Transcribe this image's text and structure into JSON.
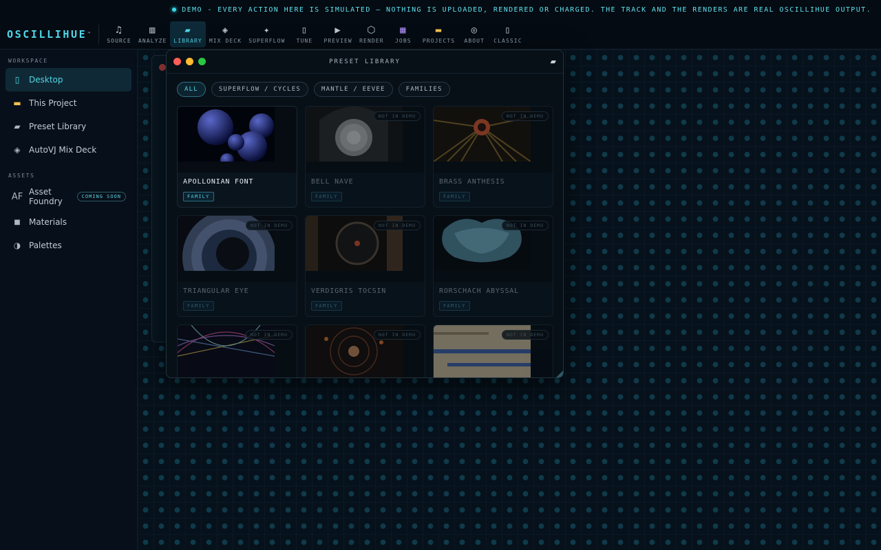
{
  "ticker": {
    "text": "DEMO - EVERY ACTION HERE IS SIMULATED — NOTHING IS UPLOADED, RENDERED OR CHARGED. THE TRACK AND THE RENDERS ARE REAL OSCILLIHUE OUTPUT."
  },
  "brand": {
    "name": "OSCILLIHUE",
    "tm": "™"
  },
  "nav": [
    {
      "label": "SOURCE",
      "icon": "music-note-icon",
      "glyph": "♫"
    },
    {
      "label": "ANALYZE",
      "icon": "bar-chart-icon",
      "glyph": "▥"
    },
    {
      "label": "LIBRARY",
      "icon": "library-icon",
      "glyph": "▰"
    },
    {
      "label": "MIX DECK",
      "icon": "mix-deck-icon",
      "glyph": "◈"
    },
    {
      "label": "SUPERFLOW",
      "icon": "sparkle-icon",
      "glyph": "✦"
    },
    {
      "label": "TUNE",
      "icon": "tune-icon",
      "glyph": "▯"
    },
    {
      "label": "PREVIEW",
      "icon": "play-icon",
      "glyph": "▶"
    },
    {
      "label": "RENDER",
      "icon": "hexagon-icon",
      "glyph": "⬡"
    },
    {
      "label": "JOBS",
      "icon": "clapper-icon",
      "glyph": "▦"
    },
    {
      "label": "PROJECTS",
      "icon": "folder-icon",
      "glyph": "▬"
    },
    {
      "label": "ABOUT",
      "icon": "target-icon",
      "glyph": "◎"
    },
    {
      "label": "CLASSIC",
      "icon": "phone-icon",
      "glyph": "▯"
    }
  ],
  "sidebar": {
    "workspace_label": "WORKSPACE",
    "workspace": [
      {
        "label": "Desktop",
        "glyph": "▯"
      },
      {
        "label": "This Project",
        "glyph": "▬"
      },
      {
        "label": "Preset Library",
        "glyph": "▰"
      },
      {
        "label": "AutoVJ Mix Deck",
        "glyph": "◈"
      }
    ],
    "assets_label": "ASSETS",
    "assets": [
      {
        "label": "Asset Foundry",
        "glyph": "AF",
        "badge": "COMING SOON"
      },
      {
        "label": "Materials",
        "glyph": "■"
      },
      {
        "label": "Palettes",
        "glyph": "◑"
      }
    ]
  },
  "window": {
    "title": "PRESET LIBRARY",
    "filters": [
      "ALL",
      "SUPERFLOW / CYCLES",
      "MANTLE / EEVEE",
      "FAMILIES"
    ],
    "cards": [
      {
        "name": "APOLLONIAN FONT",
        "tag": "FAMILY",
        "badge": ""
      },
      {
        "name": "BELL NAVE",
        "tag": "FAMILY",
        "badge": "NOT IN DEMO"
      },
      {
        "name": "BRASS ANTHESIS",
        "tag": "FAMILY",
        "badge": "NOT IN DEMO"
      },
      {
        "name": "TRIANGULAR EYE",
        "tag": "FAMILY",
        "badge": "NOT IN DEMO"
      },
      {
        "name": "VERDIGRIS TOCSIN",
        "tag": "FAMILY",
        "badge": "NOT IN DEMO"
      },
      {
        "name": "RORSCHACH ABYSSAL",
        "tag": "FAMILY",
        "badge": "NOT IN DEMO"
      },
      {
        "name": "",
        "tag": "",
        "badge": "NOT IN DEMO"
      },
      {
        "name": "",
        "tag": "",
        "badge": "NOT IN DEMO"
      },
      {
        "name": "",
        "tag": "",
        "badge": "NOT IN DEMO"
      }
    ]
  },
  "colors": {
    "accent": "#52d8ea",
    "bg": "#050b12"
  }
}
